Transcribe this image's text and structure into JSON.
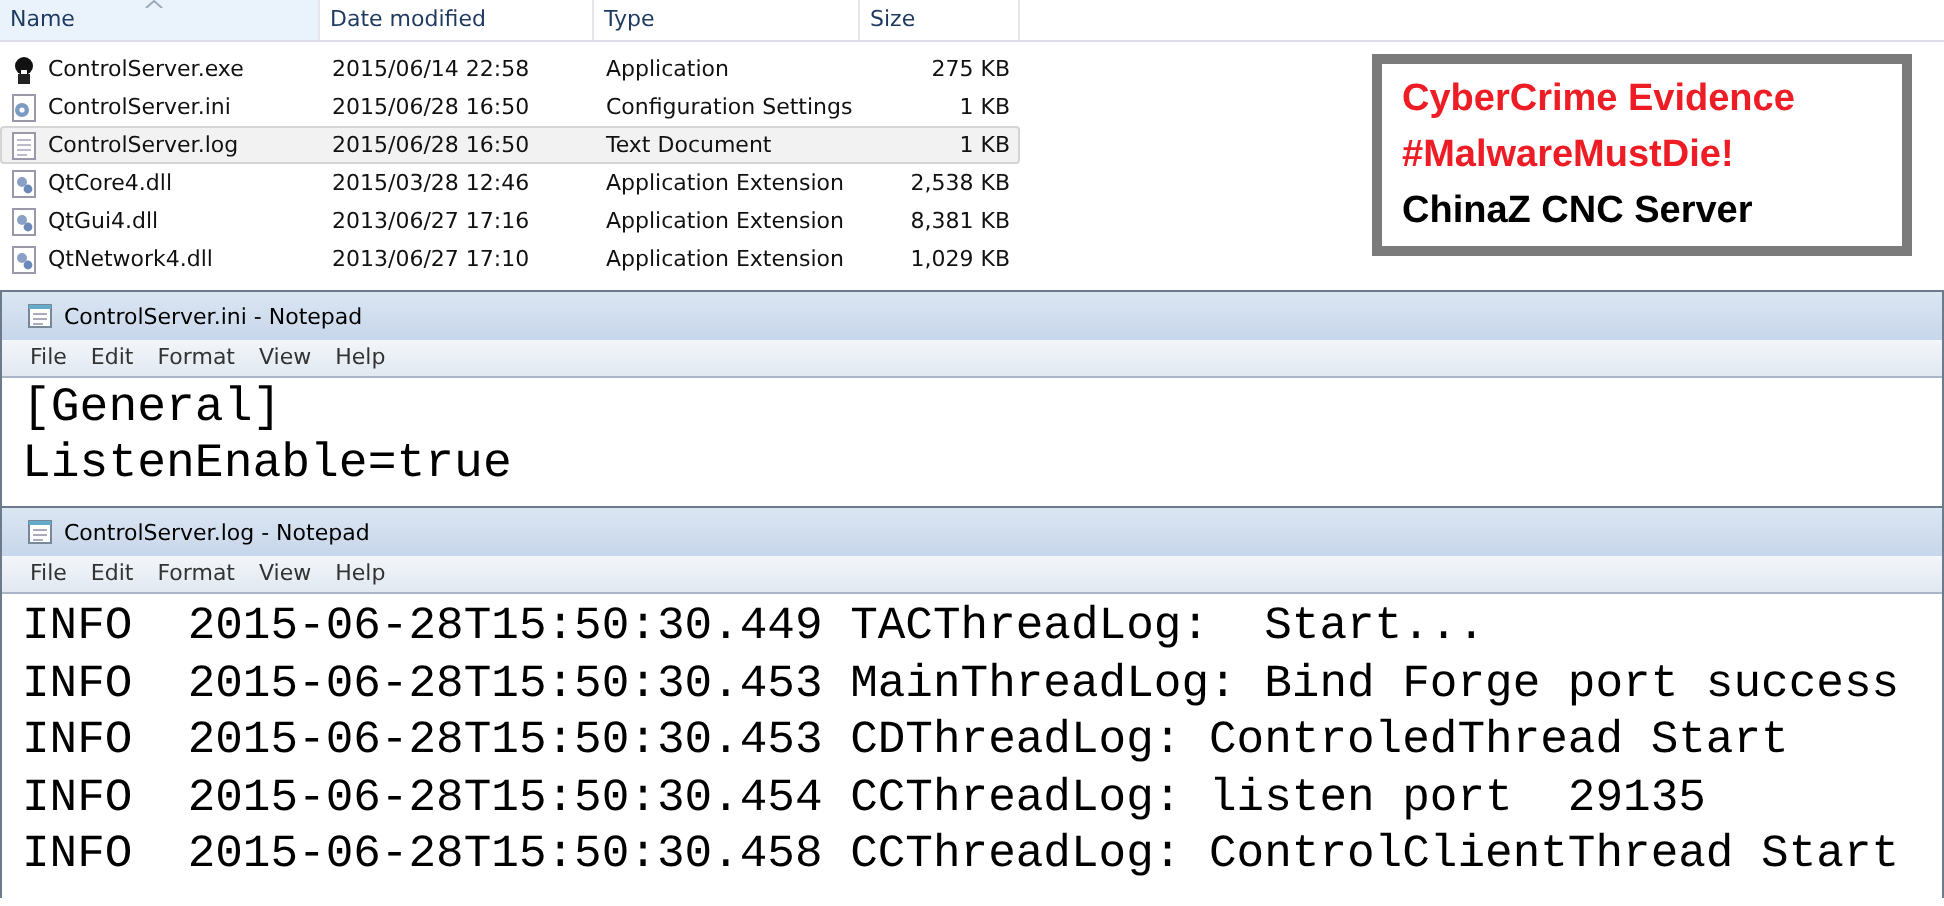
{
  "explorer": {
    "columns": [
      {
        "label": "Name",
        "sorted": true
      },
      {
        "label": "Date modified",
        "sorted": false
      },
      {
        "label": "Type",
        "sorted": false
      },
      {
        "label": "Size",
        "sorted": false
      }
    ],
    "files": [
      {
        "kind": "exe",
        "name": "ControlServer.exe",
        "date": "2015/06/14 22:58",
        "type": "Application",
        "size": "275 KB",
        "selected": false
      },
      {
        "kind": "ini",
        "name": "ControlServer.ini",
        "date": "2015/06/28 16:50",
        "type": "Configuration Settings",
        "size": "1 KB",
        "selected": false
      },
      {
        "kind": "txt",
        "name": "ControlServer.log",
        "date": "2015/06/28 16:50",
        "type": "Text Document",
        "size": "1 KB",
        "selected": true
      },
      {
        "kind": "dll",
        "name": "QtCore4.dll",
        "date": "2015/03/28 12:46",
        "type": "Application Extension",
        "size": "2,538 KB",
        "selected": false
      },
      {
        "kind": "dll",
        "name": "QtGui4.dll",
        "date": "2013/06/27 17:16",
        "type": "Application Extension",
        "size": "8,381 KB",
        "selected": false
      },
      {
        "kind": "dll",
        "name": "QtNetwork4.dll",
        "date": "2013/06/27 17:10",
        "type": "Application Extension",
        "size": "1,029 KB",
        "selected": false
      }
    ]
  },
  "banner": {
    "lines": [
      {
        "text": "CyberCrime Evidence",
        "color": "#ee1c24"
      },
      {
        "text": "#MalwareMustDie!",
        "color": "#ee1c24"
      },
      {
        "text": "ChinaZ CNC Server",
        "color": "#000000"
      }
    ]
  },
  "notepads": [
    {
      "title": "ControlServer.ini - Notepad",
      "menu": [
        "File",
        "Edit",
        "Format",
        "View",
        "Help"
      ],
      "lines": [
        "[General]",
        "ListenEnable=true"
      ]
    },
    {
      "title": "ControlServer.log - Notepad",
      "menu": [
        "File",
        "Edit",
        "Format",
        "View",
        "Help"
      ],
      "lines": [
        "INFO  2015-06-28T15:50:30.449 TACThreadLog:  Start...",
        "INFO  2015-06-28T15:50:30.453 MainThreadLog: Bind Forge port success",
        "INFO  2015-06-28T15:50:30.453 CDThreadLog: ControledThread Start",
        "INFO  2015-06-28T15:50:30.454 CCThreadLog: listen port  29135",
        "INFO  2015-06-28T15:50:30.458 CCThreadLog: ControlClientThread Start"
      ]
    }
  ]
}
